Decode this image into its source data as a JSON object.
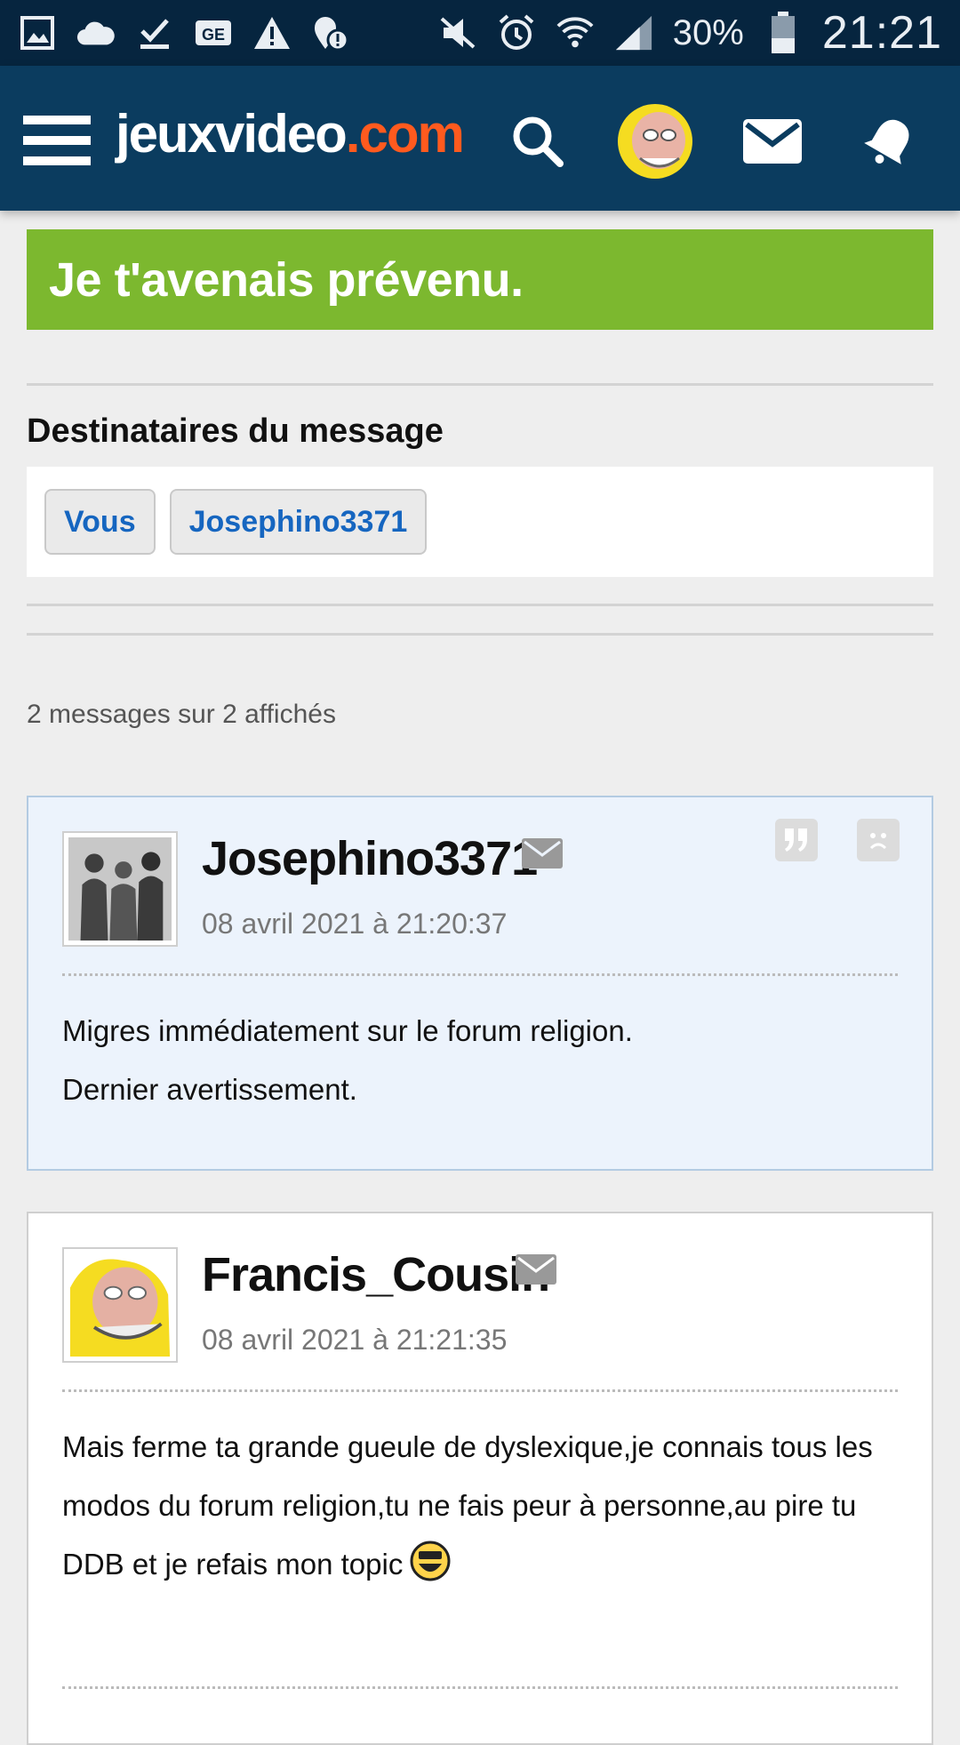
{
  "status_bar": {
    "battery": "30%",
    "clock": "21:21"
  },
  "header": {
    "logo_main": "jeuxvideo",
    "logo_suffix": ".com"
  },
  "topic": {
    "title": "Je t'avenais prévenu."
  },
  "recipients": {
    "section_title": "Destinataires du message",
    "chips": [
      "Vous",
      "Josephino3371"
    ]
  },
  "messages_count": "2 messages sur 2 affichés",
  "messages": [
    {
      "author": "Josephino3371",
      "date": "08 avril 2021 à 21:20:37",
      "lines": [
        "Migres immédiatement sur le forum religion.",
        "Dernier avertissement."
      ]
    },
    {
      "author": "Francis_Cousin",
      "date": "08 avril 2021 à 21:21:35",
      "text": "Mais ferme ta grande gueule de dyslexique,je connais tous les modos du forum religion,tu ne fais peur à personne,au pire tu DDB et je refais mon topic"
    }
  ],
  "colors": {
    "status_bar": "#06253f",
    "header": "#0b3c5f",
    "logo_accent": "#ff5a1e",
    "title_banner": "#7cb82f",
    "link": "#1666c0",
    "highlight_message_bg": "#ecf3fc"
  }
}
